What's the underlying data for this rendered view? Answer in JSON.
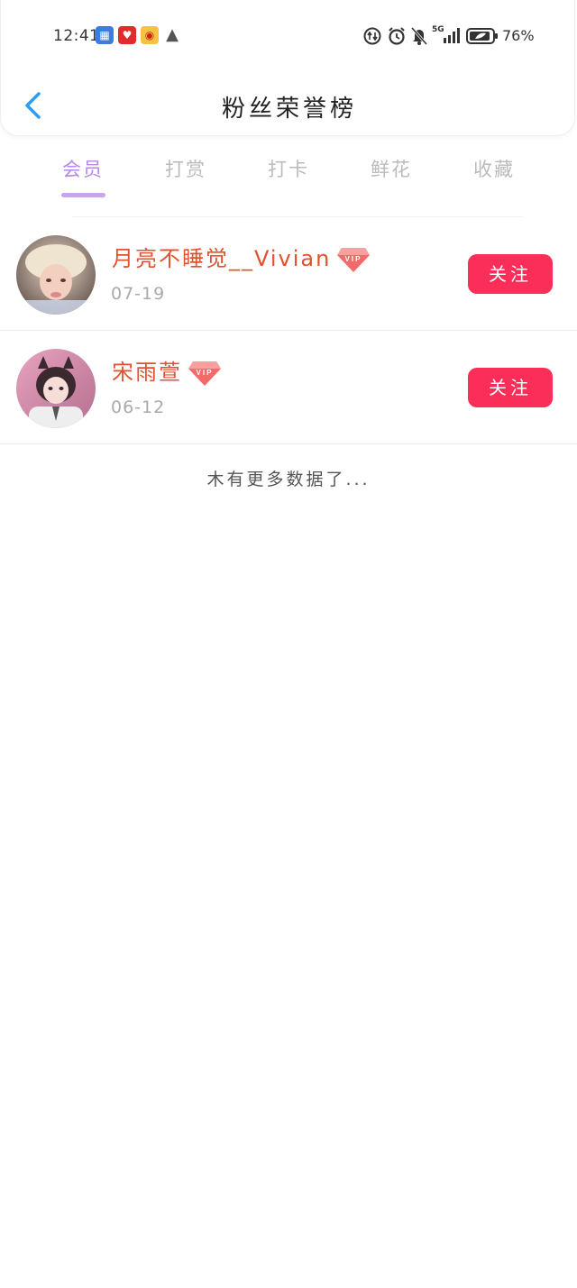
{
  "status_bar": {
    "time": "12:41",
    "app_icons": [
      "calendar-app-icon",
      "heart-app-icon",
      "weibo-app-icon",
      "qq-app-icon"
    ],
    "signal_label": "5G",
    "battery": "76%"
  },
  "header": {
    "title": "粉丝荣誉榜"
  },
  "tabs": [
    {
      "label": "会员"
    },
    {
      "label": "打赏"
    },
    {
      "label": "打卡"
    },
    {
      "label": "鲜花"
    },
    {
      "label": "收藏"
    }
  ],
  "active_tab_index": 0,
  "users": [
    {
      "name": "月亮不睡觉__Vivian",
      "date": "07-19",
      "badge": "VIP",
      "action": "关注"
    },
    {
      "name": "宋雨萱",
      "date": "06-12",
      "badge": "VIP",
      "action": "关注"
    }
  ],
  "footer_text": "木有更多数据了...",
  "colors": {
    "accent_purple": "#b88ae0",
    "name_red": "#e4512f",
    "button_red": "#fb2d59",
    "back_blue": "#2a9df4"
  }
}
